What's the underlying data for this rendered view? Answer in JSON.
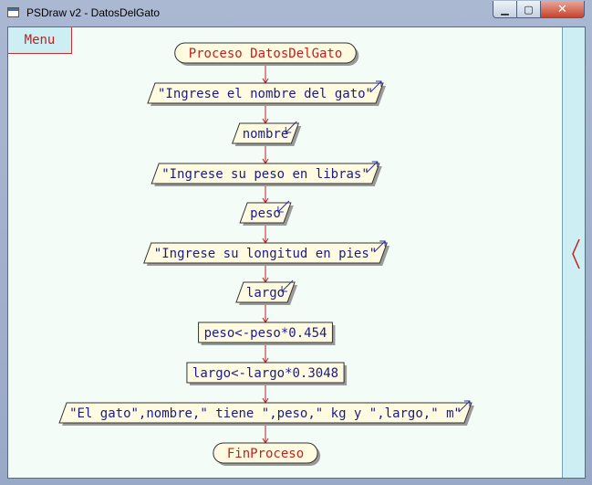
{
  "window": {
    "title": "PSDraw v2 - DatosDelGato",
    "minimize_glyph": "▁",
    "maximize_glyph": "▢",
    "close_glyph": "✕"
  },
  "menu": {
    "label": "Menu"
  },
  "side_panel": {
    "toggle_icon": "chevron-left-icon"
  },
  "colors": {
    "keyword_red": "#c02020",
    "text_blue": "#1a1a8c",
    "node_fill": "#fffbe0",
    "arrow": "#c02020",
    "canvas": "#f4fcf8",
    "panel": "#cdeef2"
  },
  "flowchart": {
    "start": {
      "keyword": "Proceso",
      "name": "DatosDelGato"
    },
    "nodes": [
      {
        "type": "output",
        "text": "\"Ingrese el nombre del gato\""
      },
      {
        "type": "input",
        "text": "nombre"
      },
      {
        "type": "output",
        "text": "\"Ingrese su peso en libras\""
      },
      {
        "type": "input",
        "text": "peso"
      },
      {
        "type": "output",
        "text": "\"Ingrese su longitud en pies\""
      },
      {
        "type": "input",
        "text": "largo"
      },
      {
        "type": "assign",
        "text": "peso<-peso*0.454"
      },
      {
        "type": "assign",
        "text": "largo<-largo*0.3048"
      },
      {
        "type": "output",
        "text": "\"El gato\",nombre,\" tiene \",peso,\" kg y \",largo,\" m\""
      }
    ],
    "end": {
      "keyword": "FinProceso"
    }
  }
}
